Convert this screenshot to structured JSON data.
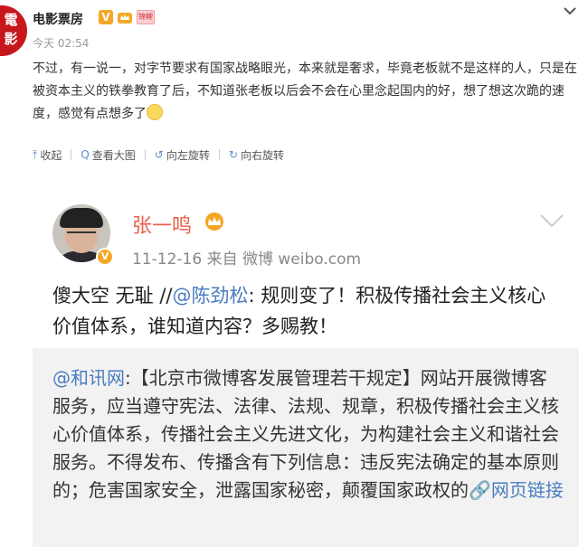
{
  "post": {
    "author": "电影票房",
    "badge_text": "锦鲤",
    "time": "今天 02:54",
    "text": "不过，有一说一，对字节要求有国家战略眼光，本来就是奢求，毕竟老板就不是这样的人，只是在被资本主义的铁拳教育了后，不知道张老板以后会不会在心里念起国内的好，想了想这次跪的速度，感觉有点想多了",
    "seal_text": "電影",
    "vip_mark": "V"
  },
  "actions": {
    "collapse": "收起",
    "view_large": "查看大图",
    "rotate_left": "向左旋转",
    "rotate_right": "向右旋转",
    "collapse_icon": "⤒",
    "view_icon": "Q",
    "rotate_left_icon": "↺",
    "rotate_right_icon": "↻"
  },
  "embedded": {
    "name": "张一鸣",
    "vip_mark": "V",
    "meta": "11-12-16  来自 微博 weibo.com",
    "text_prefix": "傻大空 无耻 //",
    "mention": "@陈劲松",
    "text_rest": ": 规则变了！积极传播社会主义核心价值体系，谁知道内容？多赐教！",
    "repost_mention": "@和讯网",
    "repost_text": ":【北京市微博客发展管理若干规定】网站开展微博客服务，应当遵守宪法、法律、法规、规章，积极传播社会主义核心价值体系，传播社会主义先进文化，为构建社会主义和谐社会服务。不得发布、传播含有下列信息：违反宪法确定的基本原则的；危害国家安全，泄露国家秘密，颠覆国家政权的",
    "link_text": "网页链接",
    "link_icon": "🔗"
  },
  "colors": {
    "accent_blue": "#4a7cc0",
    "name_orange": "#e8614a",
    "vip_gold": "#f5a623",
    "seal_red": "#c8161d"
  }
}
